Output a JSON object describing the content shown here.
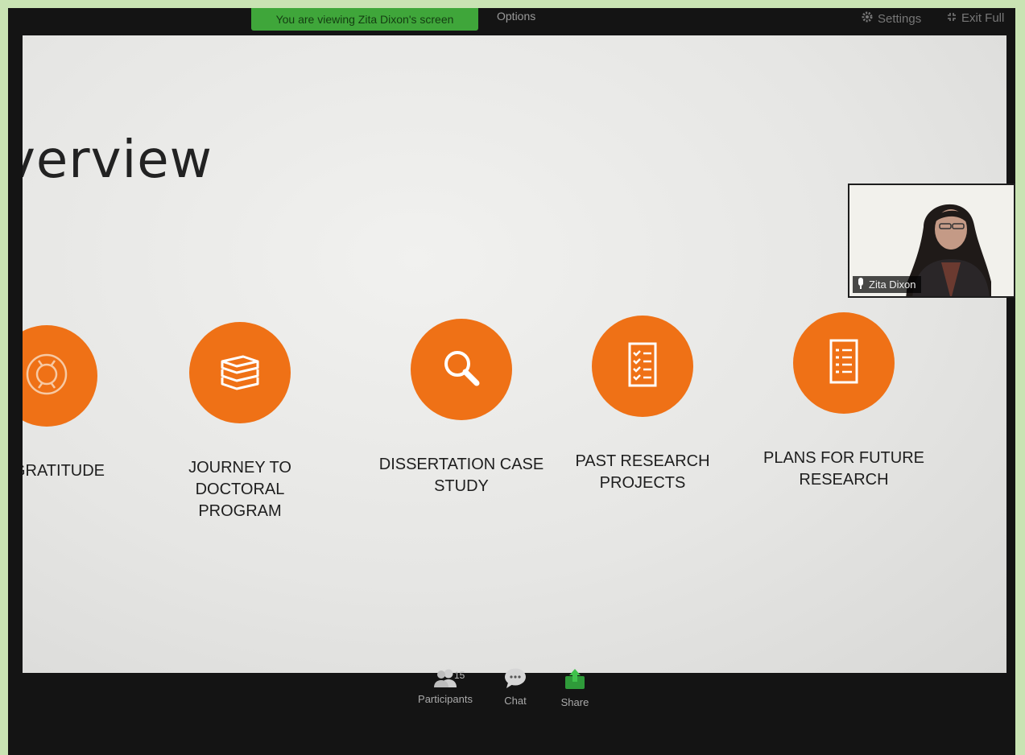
{
  "top_bar": {
    "viewing_banner": "You are viewing Zita Dixon's screen",
    "options_label": "Options",
    "settings_label": "Settings",
    "exit_label": "Exit Full"
  },
  "slide": {
    "title": "verview",
    "items": [
      {
        "label": "GRATITUDE",
        "icon": "lifebuoy-icon"
      },
      {
        "label": "JOURNEY TO DOCTORAL PROGRAM",
        "icon": "books-icon"
      },
      {
        "label": "DISSERTATION CASE STUDY",
        "icon": "magnifier-icon"
      },
      {
        "label": "PAST RESEARCH PROJECTS",
        "icon": "checklist-icon"
      },
      {
        "label": "PLANS FOR FUTURE RESEARCH",
        "icon": "list-document-icon"
      }
    ],
    "accent_color": "#ef7116"
  },
  "video": {
    "participant_name": "Zita Dixon"
  },
  "toolbar": {
    "participants_label": "Participants",
    "participants_count": "15",
    "chat_label": "Chat",
    "share_label": "Share"
  }
}
